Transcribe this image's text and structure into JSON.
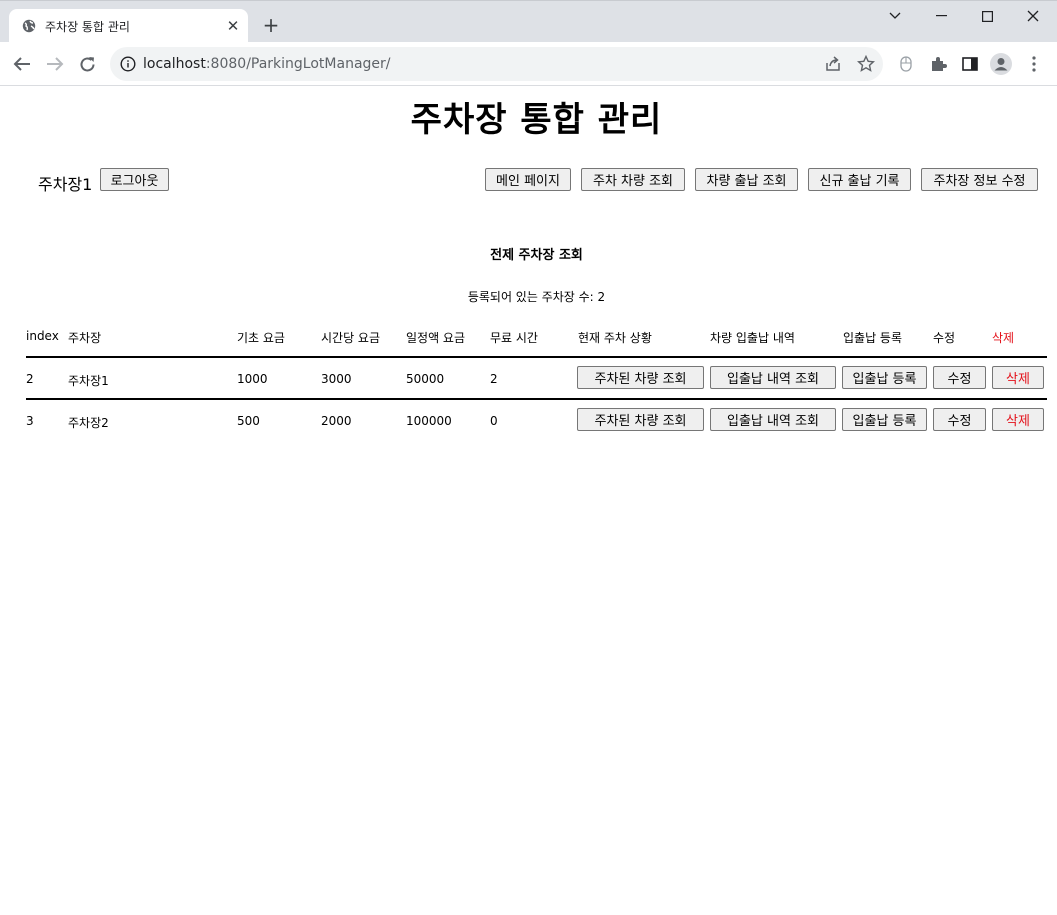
{
  "browser": {
    "tab_title": "주차장 통합 관리",
    "url_host": "localhost",
    "url_rest": ":8080/ParkingLotManager/"
  },
  "header": {
    "title": "주차장 통합 관리",
    "lot_name": "주차장1",
    "logout_label": "로그아웃",
    "nav": [
      "메인 페이지",
      "주차 차량 조회",
      "차량 출납 조회",
      "신규 출납 기록",
      "주차장 정보 수정"
    ]
  },
  "main": {
    "section_title": "전제 주차장 조회",
    "count_text": "등록되어 있는 주차장 수: 2",
    "columns": [
      "index",
      "주차장",
      "기초 요금",
      "시간당 요금",
      "일정액 요금",
      "무료 시간",
      "현재 주차 상황",
      "차량 입출납 내역",
      "입출납 등록",
      "수정",
      "삭제"
    ],
    "rows": [
      {
        "index": "2",
        "name": "주차장1",
        "base_fee": "1000",
        "hourly_fee": "3000",
        "flat_fee": "50000",
        "free_time": "2",
        "parked_btn": "주차된 차량 조회",
        "history_btn": "입출납 내역 조회",
        "register_btn": "입출납 등록",
        "edit_btn": "수정",
        "delete_btn": "삭제"
      },
      {
        "index": "3",
        "name": "주차장2",
        "base_fee": "500",
        "hourly_fee": "2000",
        "flat_fee": "100000",
        "free_time": "0",
        "parked_btn": "주차된 차량 조회",
        "history_btn": "입출납 내역 조회",
        "register_btn": "입출납 등록",
        "edit_btn": "수정",
        "delete_btn": "삭제"
      }
    ]
  },
  "colors": {
    "delete_red": "#e4111a",
    "tab_strip": "#dee1e6",
    "omnibox": "#f1f3f4"
  },
  "icons": [
    "globe-icon",
    "close-icon",
    "plus-icon",
    "chevron-down-icon",
    "minimize-icon",
    "maximize-icon",
    "window-close-icon",
    "back-icon",
    "forward-icon",
    "reload-icon",
    "info-icon",
    "share-icon",
    "star-icon",
    "mouse-icon",
    "extensions-icon",
    "side-panel-icon",
    "profile-icon",
    "kebab-menu-icon"
  ]
}
